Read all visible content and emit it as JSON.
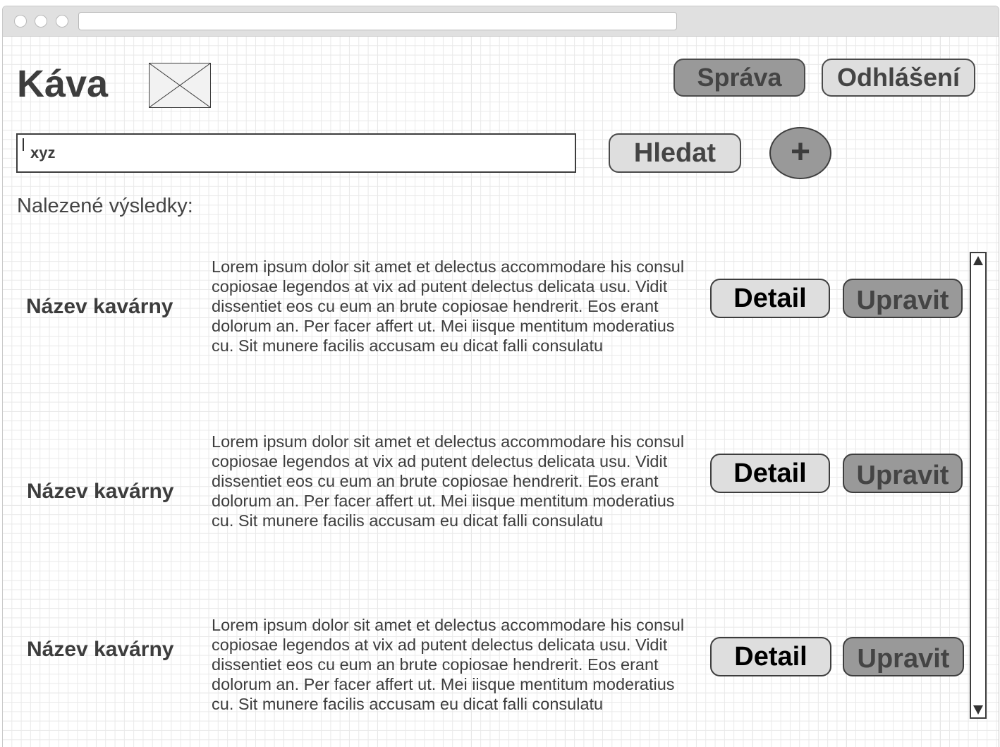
{
  "window": {
    "url": ""
  },
  "header": {
    "title": "Káva",
    "logo_icon": "image-placeholder-icon",
    "admin_label": "Správa",
    "logout_label": "Odhlášení"
  },
  "search": {
    "value": "xyz",
    "button_label": "Hledat",
    "add_label": "+"
  },
  "results": {
    "label": "Nalezené výsledky:",
    "items": [
      {
        "name": "Název kavárny",
        "description": "Lorem ipsum dolor sit amet et delectus accommodare his consul copiosae legendos at vix ad putent delectus delicata usu. Vidit dissentiet eos cu eum an brute copiosae hendrerit. Eos erant dolorum an. Per facer affert ut. Mei iisque mentitum moderatius cu. Sit munere facilis accusam eu dicat falli consulatu",
        "detail_label": "Detail",
        "edit_label": "Upravit"
      },
      {
        "name": "Název kavárny",
        "description": "Lorem ipsum dolor sit amet et delectus accommodare his consul copiosae legendos at vix ad putent delectus delicata usu. Vidit dissentiet eos cu eum an brute copiosae hendrerit. Eos erant dolorum an. Per facer affert ut. Mei iisque mentitum moderatius cu. Sit munere facilis accusam eu dicat falli consulatu",
        "detail_label": "Detail",
        "edit_label": "Upravit"
      },
      {
        "name": "Název kavárny",
        "description": "Lorem ipsum dolor sit amet et delectus accommodare his consul copiosae legendos at vix ad putent delectus delicata usu. Vidit dissentiet eos cu eum an brute copiosae hendrerit. Eos erant dolorum an. Per facer affert ut. Mei iisque mentitum moderatius cu. Sit munere facilis accusam eu dicat falli consulatu",
        "detail_label": "Detail",
        "edit_label": "Upravit"
      }
    ]
  },
  "scrollbar": {
    "up_icon": "arrow-up-icon",
    "down_icon": "arrow-down-icon"
  },
  "colors": {
    "dark_button": "#999999",
    "light_button": "#dedede",
    "text": "#3d3d3d"
  }
}
